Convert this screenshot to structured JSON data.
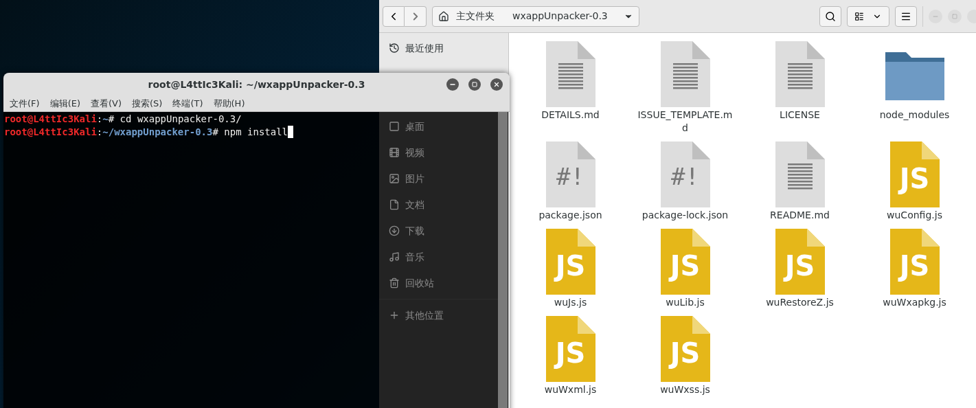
{
  "file_manager": {
    "path": [
      {
        "kind": "home",
        "label": "主文件夹"
      },
      {
        "kind": "folder",
        "label": "wxappUnpacker-0.3"
      }
    ],
    "sidebar": [
      {
        "kind": "recent",
        "label": "最近使用"
      },
      {
        "kind": "desktop",
        "label": "桌面"
      },
      {
        "kind": "videos",
        "label": "视频"
      },
      {
        "kind": "pictures",
        "label": "图片"
      },
      {
        "kind": "documents",
        "label": "文档"
      },
      {
        "kind": "downloads",
        "label": "下载"
      },
      {
        "kind": "music",
        "label": "音乐"
      },
      {
        "kind": "trash",
        "label": "回收站"
      },
      {
        "kind": "other",
        "label": "其他位置"
      }
    ],
    "files": [
      {
        "kind": "text",
        "name": "DETAILS.md"
      },
      {
        "kind": "text",
        "name": "ISSUE_TEMPLATE.md"
      },
      {
        "kind": "text",
        "name": "LICENSE"
      },
      {
        "kind": "folder",
        "name": "node_modules"
      },
      {
        "kind": "script",
        "glyph": "#!",
        "name": "package.json"
      },
      {
        "kind": "script",
        "glyph": "#!",
        "name": "package-lock.json"
      },
      {
        "kind": "text",
        "name": "README.md"
      },
      {
        "kind": "js",
        "glyph": "JS",
        "name": "wuConfig.js"
      },
      {
        "kind": "js",
        "glyph": "JS",
        "name": "wuJs.js"
      },
      {
        "kind": "js",
        "glyph": "JS",
        "name": "wuLib.js"
      },
      {
        "kind": "js",
        "glyph": "JS",
        "name": "wuRestoreZ.js"
      },
      {
        "kind": "js",
        "glyph": "JS",
        "name": "wuWxapkg.js"
      },
      {
        "kind": "js",
        "glyph": "JS",
        "name": "wuWxml.js"
      },
      {
        "kind": "js",
        "glyph": "JS",
        "name": "wuWxss.js"
      }
    ]
  },
  "terminal": {
    "title": "root@L4ttIc3Kali: ~/wxappUnpacker-0.3",
    "menu": [
      "文件(F)",
      "编辑(E)",
      "查看(V)",
      "搜索(S)",
      "终端(T)",
      "帮助(H)"
    ],
    "lines": [
      {
        "cursor": false,
        "parts": [
          {
            "kind": "user",
            "text": "root@L4ttIc3Kali"
          },
          {
            "kind": "plain",
            "text": ":"
          },
          {
            "kind": "path",
            "text": "~"
          },
          {
            "kind": "plain",
            "text": "# cd wxappUnpacker-0.3/"
          }
        ]
      },
      {
        "cursor": true,
        "parts": [
          {
            "kind": "user",
            "text": "root@L4ttIc3Kali"
          },
          {
            "kind": "plain",
            "text": ":"
          },
          {
            "kind": "path",
            "text": "~/wxappUnpacker-0.3"
          },
          {
            "kind": "plain",
            "text": "# npm install"
          }
        ]
      }
    ]
  }
}
